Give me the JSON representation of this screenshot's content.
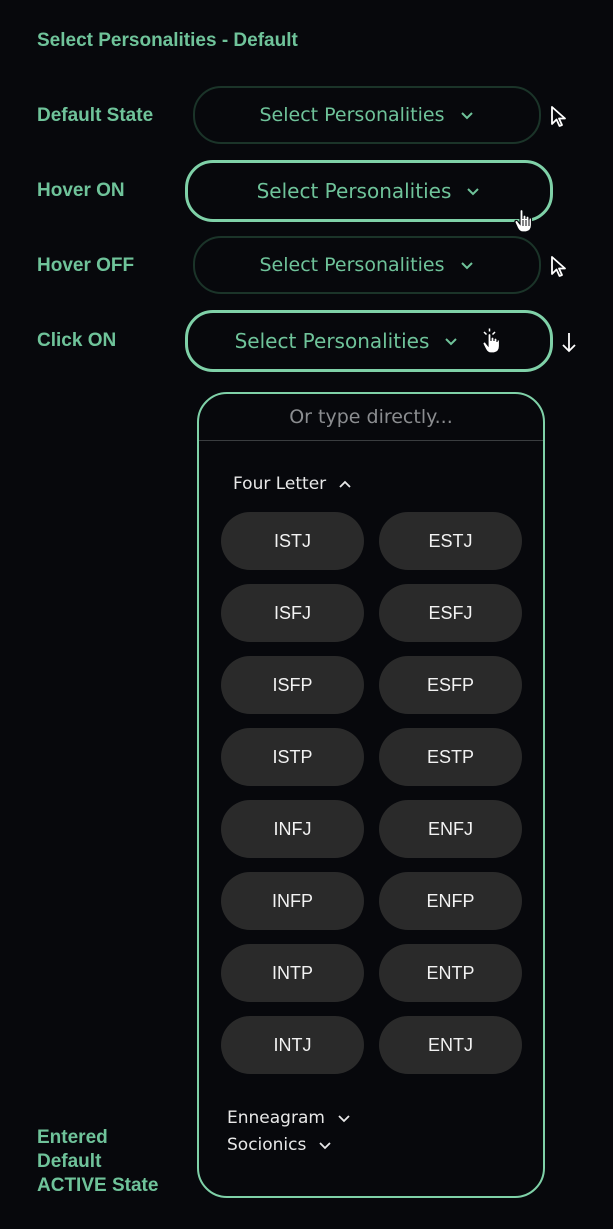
{
  "title": "Select Personalities - Default",
  "rows": [
    {
      "label": "Default State",
      "select_label": "Select Personalities",
      "cursor": "arrow-cursor-icon"
    },
    {
      "label": "Hover ON",
      "select_label": "Select Personalities",
      "cursor": "hand-pointer-icon"
    },
    {
      "label": "Hover OFF",
      "select_label": "Select Personalities",
      "cursor": "arrow-cursor-icon"
    },
    {
      "label": "Click ON",
      "select_label": "Select Personalities",
      "cursor": "hand-click-icon"
    }
  ],
  "dropdown": {
    "placeholder": "Or type directly...",
    "four_letter": {
      "label": "Four Letter",
      "expanded": true,
      "types": [
        "ISTJ",
        "ESTJ",
        "ISFJ",
        "ESFJ",
        "ISFP",
        "ESFP",
        "ISTP",
        "ESTP",
        "INFJ",
        "ENFJ",
        "INFP",
        "ENFP",
        "INTP",
        "ENTP",
        "INTJ",
        "ENTJ"
      ]
    },
    "enneagram": {
      "label": "Enneagram",
      "expanded": false
    },
    "socionics": {
      "label": "Socionics",
      "expanded": false
    }
  },
  "bottom_label": [
    "Entered",
    "Default",
    "ACTIVE State"
  ],
  "colors": {
    "background": "#07080c",
    "accent": "#6fc39a",
    "accent_border": "#7fd1a8",
    "pill_bg": "#2a2a2a"
  }
}
